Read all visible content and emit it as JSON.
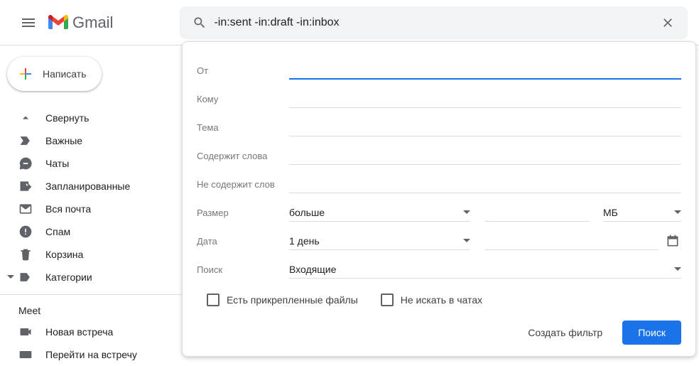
{
  "header": {
    "brand": "Gmail",
    "search_value": "-in:sent -in:draft -in:inbox"
  },
  "compose_label": "Написать",
  "sidebar": {
    "items": [
      {
        "label": "Свернуть"
      },
      {
        "label": "Важные"
      },
      {
        "label": "Чаты"
      },
      {
        "label": "Запланированные"
      },
      {
        "label": "Вся почта"
      },
      {
        "label": "Спам"
      },
      {
        "label": "Корзина"
      },
      {
        "label": "Категории"
      }
    ]
  },
  "meet": {
    "title": "Meet",
    "items": [
      {
        "label": "Новая встреча"
      },
      {
        "label": "Перейти на встречу"
      }
    ]
  },
  "adv": {
    "from_label": "От",
    "to_label": "Кому",
    "subject_label": "Тема",
    "has_label": "Содержит слова",
    "nothas_label": "Не содержит слов",
    "size_label": "Размер",
    "size_op": "больше",
    "size_unit": "МБ",
    "date_label": "Дата",
    "date_range": "1 день",
    "search_label": "Поиск",
    "search_in": "Входящие",
    "cb_attach": "Есть прикрепленные файлы",
    "cb_nochat": "Не искать в чатах",
    "create_filter": "Создать фильтр",
    "search_btn": "Поиск"
  }
}
